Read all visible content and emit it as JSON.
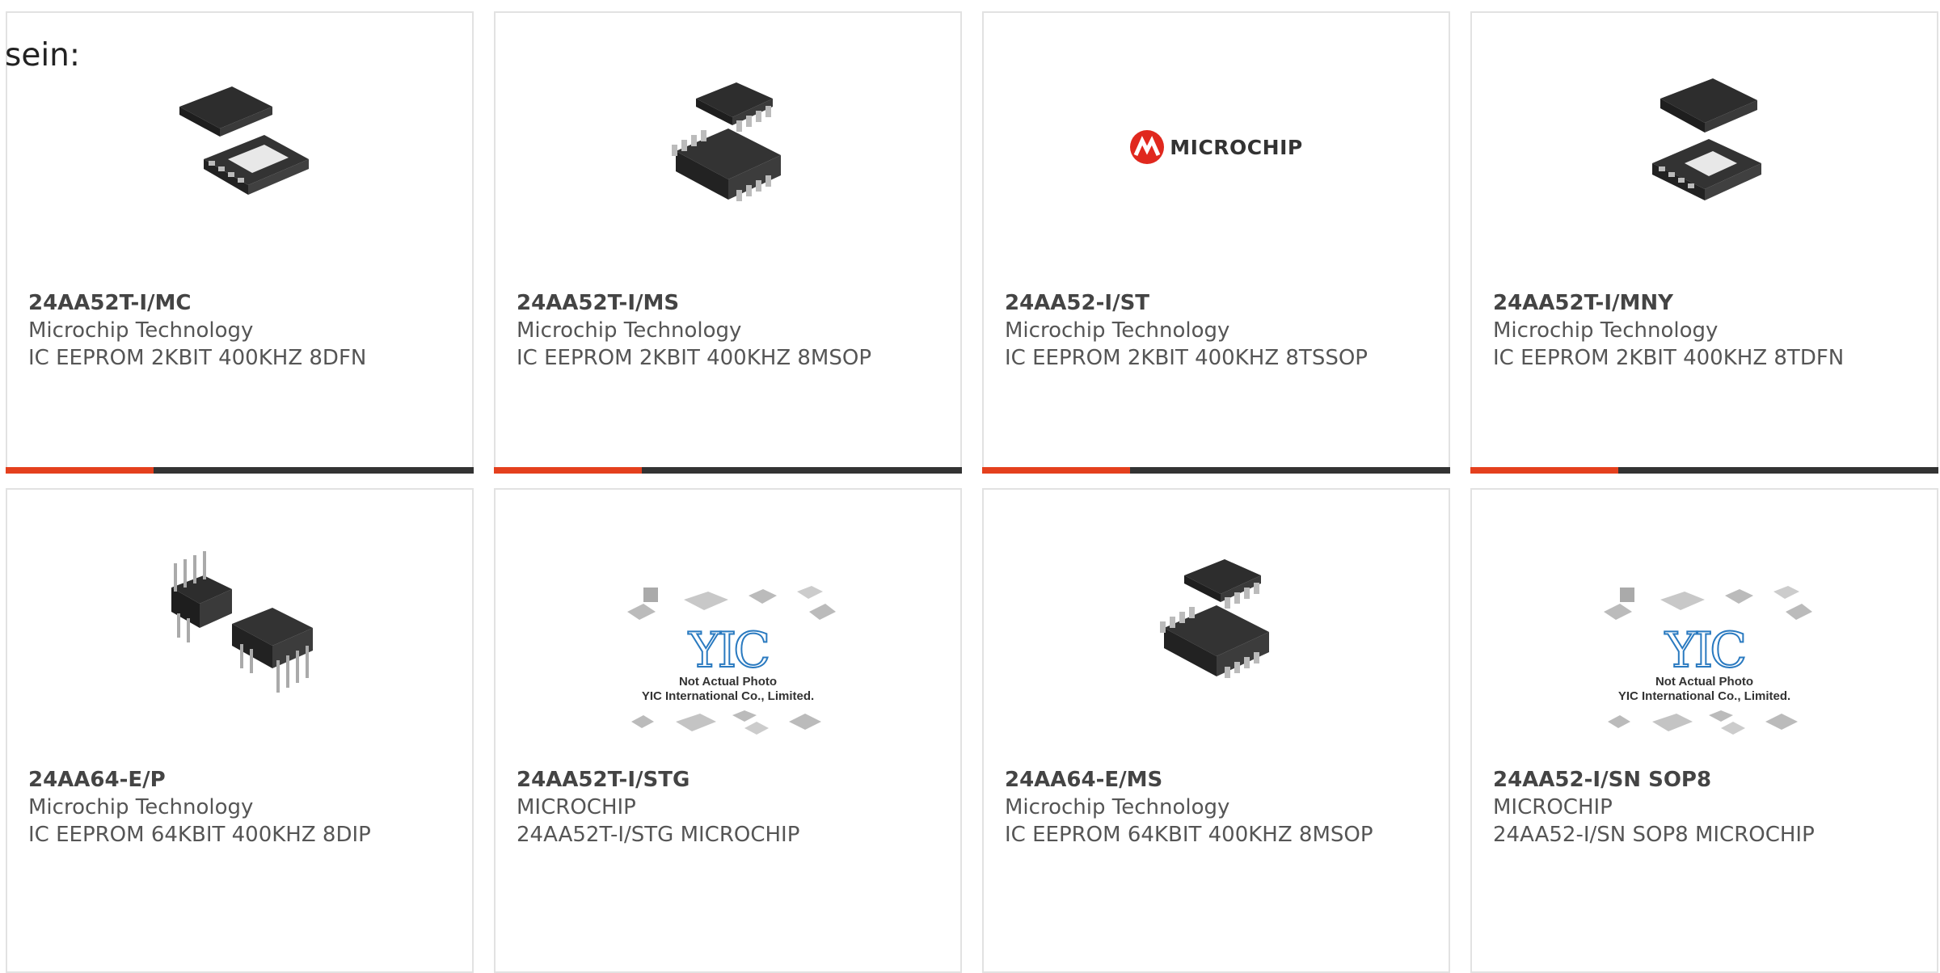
{
  "intro_text": "sein:",
  "colors": {
    "accent": "#e4401e",
    "bar": "#333333",
    "border": "#e2e2e2",
    "text": "#555555"
  },
  "products": [
    {
      "part": "24AA52T-I/MC",
      "manufacturer": "Microchip Technology",
      "description": "IC EEPROM 2KBIT 400KHZ 8DFN",
      "image": "dfn-8-chip-icon"
    },
    {
      "part": "24AA52T-I/MS",
      "manufacturer": "Microchip Technology",
      "description": "IC EEPROM 2KBIT 400KHZ 8MSOP",
      "image": "msop-8-chip-icon"
    },
    {
      "part": "24AA52-I/ST",
      "manufacturer": "Microchip Technology",
      "description": "IC EEPROM 2KBIT 400KHZ 8TSSOP",
      "image": "microchip-logo",
      "image_text": "MICROCHIP"
    },
    {
      "part": "24AA52T-I/MNY",
      "manufacturer": "Microchip Technology",
      "description": "IC EEPROM 2KBIT 400KHZ 8TDFN",
      "image": "tdfn-8-chip-icon"
    },
    {
      "part": "24AA64-E/P",
      "manufacturer": "Microchip Technology",
      "description": "IC EEPROM 64KBIT 400KHZ 8DIP",
      "image": "dip-8-chip-icon"
    },
    {
      "part": "24AA52T-I/STG",
      "manufacturer": "MICROCHIP",
      "description": "24AA52T-I/STG MICROCHIP",
      "image": "yic-placeholder",
      "image_text": "YIC",
      "image_caption1": "Not Actual Photo",
      "image_caption2": "YIC International Co., Limited."
    },
    {
      "part": "24AA64-E/MS",
      "manufacturer": "Microchip Technology",
      "description": "IC EEPROM 64KBIT 400KHZ 8MSOP",
      "image": "msop-8-chip-icon"
    },
    {
      "part": "24AA52-I/SN SOP8",
      "manufacturer": "MICROCHIP",
      "description": "24AA52-I/SN SOP8 MICROCHIP",
      "image": "yic-placeholder",
      "image_text": "YIC",
      "image_caption1": "Not Actual Photo",
      "image_caption2": "YIC International Co., Limited."
    }
  ]
}
